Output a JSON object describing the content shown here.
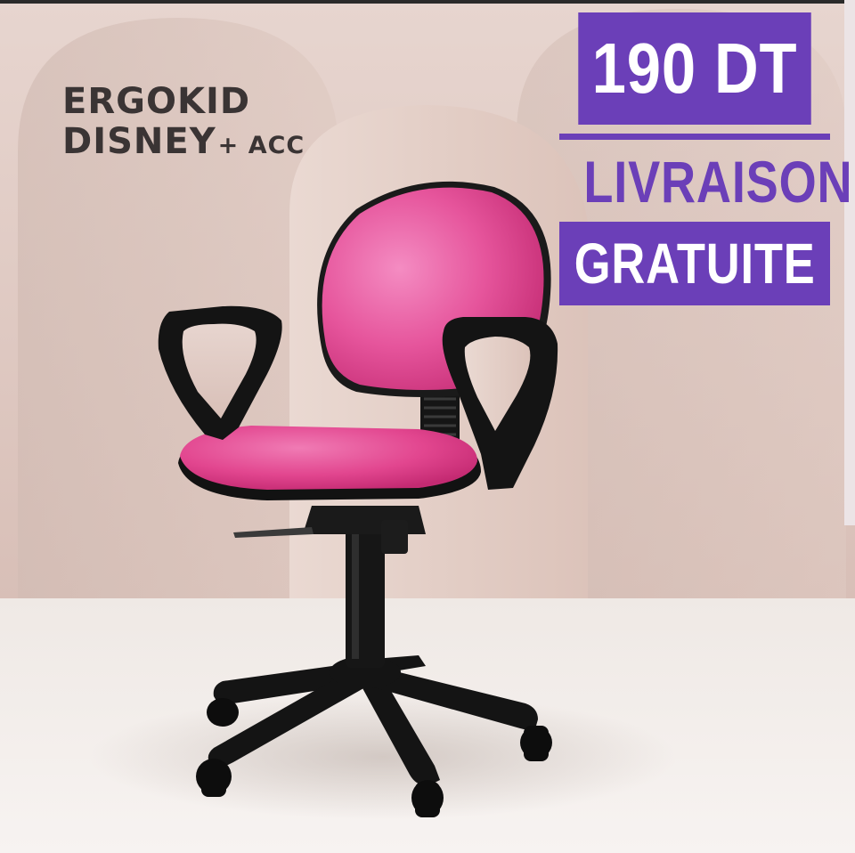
{
  "brand": {
    "line1": "ERGOKID",
    "line2": "DISNEY",
    "line2_suffix": "+ ACC"
  },
  "promo": {
    "price": "190 DT",
    "delivery_line1": "LIVRAISON",
    "delivery_line2": "GRATUITE"
  },
  "colors": {
    "accent": "#6b3fb8",
    "brand_text": "#3a3434",
    "chair_seat": "#e2468f",
    "chair_frame": "#111111"
  }
}
